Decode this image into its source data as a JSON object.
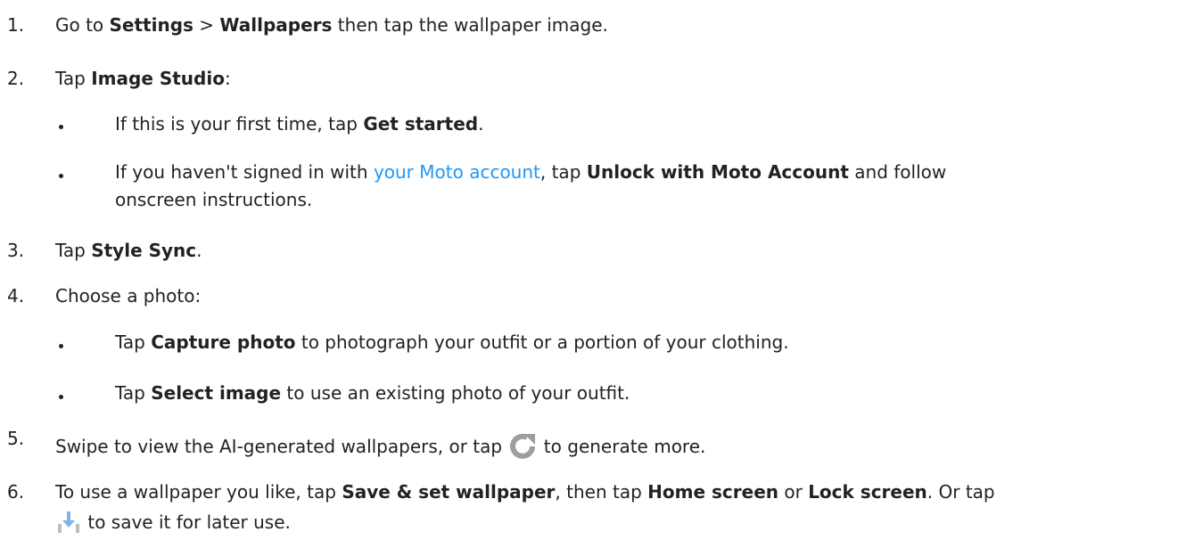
{
  "steps": [
    {
      "num": "1.",
      "a": "Go to ",
      "b1": "Settings",
      "c": " > ",
      "b2": "Wallpapers",
      "d": " then tap the wallpaper image."
    },
    {
      "num": "2.",
      "a": "Tap ",
      "b1": "Image Studio",
      "c": ":",
      "subs": [
        {
          "a": "If this is your first time, tap ",
          "b": "Get started",
          "c": "."
        },
        {
          "a": "If you haven't signed in with ",
          "link": "your Moto account",
          "c": ", tap ",
          "b": "Unlock with Moto Account",
          "d": " and follow",
          "line2": "onscreen instructions."
        }
      ]
    },
    {
      "num": "3.",
      "a": "Tap ",
      "b1": "Style Sync",
      "c": "."
    },
    {
      "num": "4.",
      "a": "Choose a photo:",
      "subs": [
        {
          "a": "Tap ",
          "b": "Capture photo",
          "c": " to photograph your outfit or a portion of your clothing."
        },
        {
          "a": "Tap ",
          "b": "Select image",
          "c": " to use an existing photo of your outfit."
        }
      ]
    },
    {
      "num": "5.",
      "a": "Swipe to view the AI-generated wallpapers, or tap ",
      "icon": "refresh-icon",
      "c": " to generate more."
    },
    {
      "num": "6.",
      "a": "To use a wallpaper you like, tap ",
      "b1": "Save & set wallpaper",
      "c": ", then tap ",
      "b2": "Home screen",
      "d": " or ",
      "b3": "Lock screen",
      "e": ". Or tap",
      "icon": "download-icon",
      "line2": " to save it for later use."
    }
  ]
}
